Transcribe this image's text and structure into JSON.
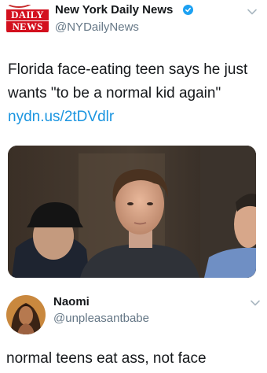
{
  "tweet": {
    "author": {
      "display_name": "New York Daily News",
      "handle": "@NYDailyNews",
      "verified": true,
      "avatar_logo": [
        "DAILY",
        "NEWS"
      ]
    },
    "text": "Florida face-eating teen says he just wants \"to be a normal kid again\"",
    "link": "nydn.us/2tDVdlr",
    "menu_icon": "chevron-down-icon",
    "media_icon": "news-photo"
  },
  "reply": {
    "author": {
      "display_name": "Naomi",
      "handle": "@unpleasantbabe"
    },
    "text": "normal teens eat ass, not face",
    "menu_icon": "chevron-down-icon"
  },
  "colors": {
    "link": "#1b95e0",
    "verified": "#1da1f2",
    "handle": "#657786",
    "brand_red": "#d3101e"
  }
}
